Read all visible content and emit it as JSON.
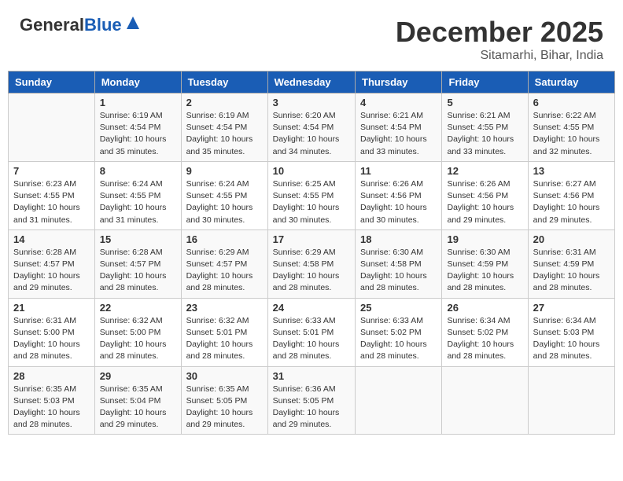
{
  "header": {
    "logo_line1": "General",
    "logo_line2": "Blue",
    "month": "December 2025",
    "location": "Sitamarhi, Bihar, India"
  },
  "days_of_week": [
    "Sunday",
    "Monday",
    "Tuesday",
    "Wednesday",
    "Thursday",
    "Friday",
    "Saturday"
  ],
  "weeks": [
    [
      {
        "day": "",
        "info": ""
      },
      {
        "day": "1",
        "info": "Sunrise: 6:19 AM\nSunset: 4:54 PM\nDaylight: 10 hours\nand 35 minutes."
      },
      {
        "day": "2",
        "info": "Sunrise: 6:19 AM\nSunset: 4:54 PM\nDaylight: 10 hours\nand 35 minutes."
      },
      {
        "day": "3",
        "info": "Sunrise: 6:20 AM\nSunset: 4:54 PM\nDaylight: 10 hours\nand 34 minutes."
      },
      {
        "day": "4",
        "info": "Sunrise: 6:21 AM\nSunset: 4:54 PM\nDaylight: 10 hours\nand 33 minutes."
      },
      {
        "day": "5",
        "info": "Sunrise: 6:21 AM\nSunset: 4:55 PM\nDaylight: 10 hours\nand 33 minutes."
      },
      {
        "day": "6",
        "info": "Sunrise: 6:22 AM\nSunset: 4:55 PM\nDaylight: 10 hours\nand 32 minutes."
      }
    ],
    [
      {
        "day": "7",
        "info": "Sunrise: 6:23 AM\nSunset: 4:55 PM\nDaylight: 10 hours\nand 31 minutes."
      },
      {
        "day": "8",
        "info": "Sunrise: 6:24 AM\nSunset: 4:55 PM\nDaylight: 10 hours\nand 31 minutes."
      },
      {
        "day": "9",
        "info": "Sunrise: 6:24 AM\nSunset: 4:55 PM\nDaylight: 10 hours\nand 30 minutes."
      },
      {
        "day": "10",
        "info": "Sunrise: 6:25 AM\nSunset: 4:55 PM\nDaylight: 10 hours\nand 30 minutes."
      },
      {
        "day": "11",
        "info": "Sunrise: 6:26 AM\nSunset: 4:56 PM\nDaylight: 10 hours\nand 30 minutes."
      },
      {
        "day": "12",
        "info": "Sunrise: 6:26 AM\nSunset: 4:56 PM\nDaylight: 10 hours\nand 29 minutes."
      },
      {
        "day": "13",
        "info": "Sunrise: 6:27 AM\nSunset: 4:56 PM\nDaylight: 10 hours\nand 29 minutes."
      }
    ],
    [
      {
        "day": "14",
        "info": "Sunrise: 6:28 AM\nSunset: 4:57 PM\nDaylight: 10 hours\nand 29 minutes."
      },
      {
        "day": "15",
        "info": "Sunrise: 6:28 AM\nSunset: 4:57 PM\nDaylight: 10 hours\nand 28 minutes."
      },
      {
        "day": "16",
        "info": "Sunrise: 6:29 AM\nSunset: 4:57 PM\nDaylight: 10 hours\nand 28 minutes."
      },
      {
        "day": "17",
        "info": "Sunrise: 6:29 AM\nSunset: 4:58 PM\nDaylight: 10 hours\nand 28 minutes."
      },
      {
        "day": "18",
        "info": "Sunrise: 6:30 AM\nSunset: 4:58 PM\nDaylight: 10 hours\nand 28 minutes."
      },
      {
        "day": "19",
        "info": "Sunrise: 6:30 AM\nSunset: 4:59 PM\nDaylight: 10 hours\nand 28 minutes."
      },
      {
        "day": "20",
        "info": "Sunrise: 6:31 AM\nSunset: 4:59 PM\nDaylight: 10 hours\nand 28 minutes."
      }
    ],
    [
      {
        "day": "21",
        "info": "Sunrise: 6:31 AM\nSunset: 5:00 PM\nDaylight: 10 hours\nand 28 minutes."
      },
      {
        "day": "22",
        "info": "Sunrise: 6:32 AM\nSunset: 5:00 PM\nDaylight: 10 hours\nand 28 minutes."
      },
      {
        "day": "23",
        "info": "Sunrise: 6:32 AM\nSunset: 5:01 PM\nDaylight: 10 hours\nand 28 minutes."
      },
      {
        "day": "24",
        "info": "Sunrise: 6:33 AM\nSunset: 5:01 PM\nDaylight: 10 hours\nand 28 minutes."
      },
      {
        "day": "25",
        "info": "Sunrise: 6:33 AM\nSunset: 5:02 PM\nDaylight: 10 hours\nand 28 minutes."
      },
      {
        "day": "26",
        "info": "Sunrise: 6:34 AM\nSunset: 5:02 PM\nDaylight: 10 hours\nand 28 minutes."
      },
      {
        "day": "27",
        "info": "Sunrise: 6:34 AM\nSunset: 5:03 PM\nDaylight: 10 hours\nand 28 minutes."
      }
    ],
    [
      {
        "day": "28",
        "info": "Sunrise: 6:35 AM\nSunset: 5:03 PM\nDaylight: 10 hours\nand 28 minutes."
      },
      {
        "day": "29",
        "info": "Sunrise: 6:35 AM\nSunset: 5:04 PM\nDaylight: 10 hours\nand 29 minutes."
      },
      {
        "day": "30",
        "info": "Sunrise: 6:35 AM\nSunset: 5:05 PM\nDaylight: 10 hours\nand 29 minutes."
      },
      {
        "day": "31",
        "info": "Sunrise: 6:36 AM\nSunset: 5:05 PM\nDaylight: 10 hours\nand 29 minutes."
      },
      {
        "day": "",
        "info": ""
      },
      {
        "day": "",
        "info": ""
      },
      {
        "day": "",
        "info": ""
      }
    ]
  ]
}
